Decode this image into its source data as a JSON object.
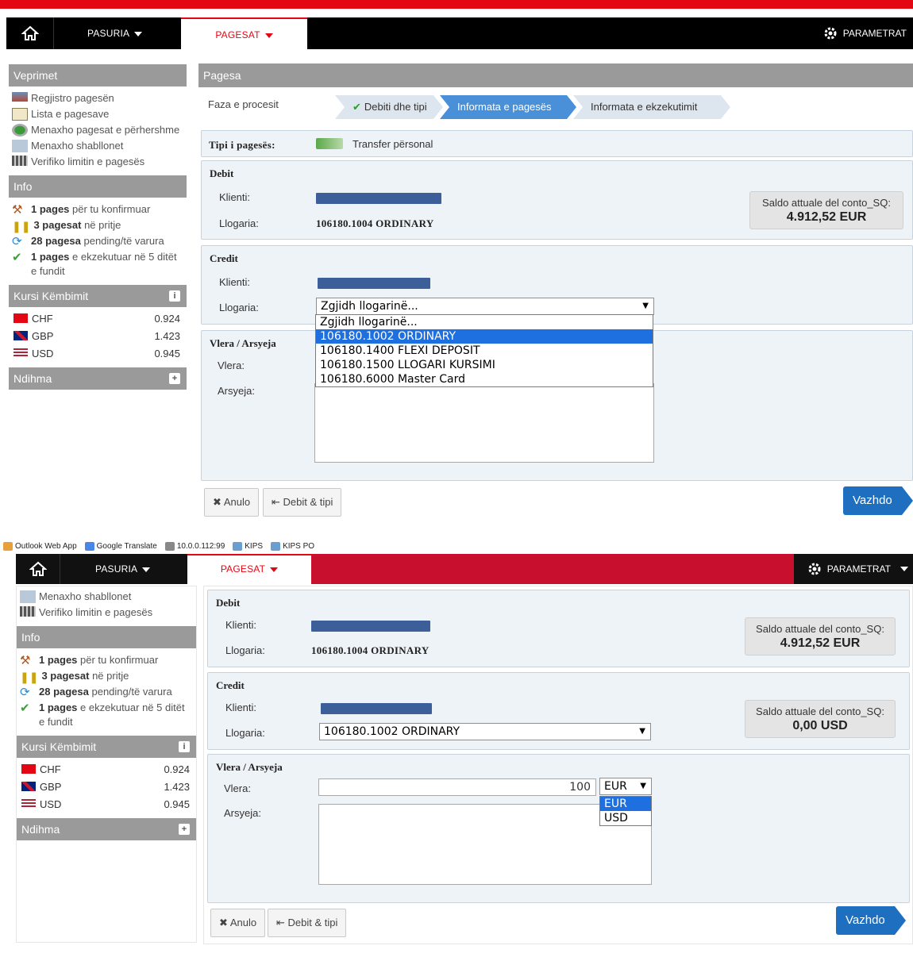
{
  "nav": {
    "pasuria": "PASURIA",
    "pagesat": "PAGESAT",
    "parametrat": "PARAMETRAT"
  },
  "bookmarks": [
    "Outlook Web App",
    "Google Translate",
    "10.0.0.112:99",
    "KIPS",
    "KIPS PO"
  ],
  "sidebar": {
    "veprimet_title": "Veprimet",
    "veprimet": [
      "Regjistro pagesën",
      "Lista e pagesave",
      "Menaxho pagesat e përhershme",
      "Menaxho shabllonet",
      "Verifiko limitin e pagesës"
    ],
    "info_title": "Info",
    "info": [
      {
        "bold": "1 pages",
        "rest": " për tu konfirmuar"
      },
      {
        "bold": "3 pagesat",
        "rest": " në pritje"
      },
      {
        "bold": "28 pagesa",
        "rest": " pending/të varura"
      },
      {
        "bold": "1 pages",
        "rest": " e ekzekutuar në 5 ditët e fundit"
      }
    ],
    "kursi_title": "Kursi Këmbimit",
    "rates": [
      {
        "code": "CHF",
        "rate": "0.924"
      },
      {
        "code": "GBP",
        "rate": "1.423"
      },
      {
        "code": "USD",
        "rate": "0.945"
      }
    ],
    "ndihma_title": "Ndihma"
  },
  "main": {
    "title": "Pagesa",
    "phase_label": "Faza e procesit",
    "steps": [
      "Debiti dhe tipi",
      "Informata e pagesës",
      "Informata e ekzekutimit"
    ],
    "tipi_label": "Tipi i pagesës:",
    "tipi_value": "Transfer përsonal",
    "debit": {
      "title": "Debit",
      "klienti_label": "Klienti:",
      "llogaria_label": "Llogaria:",
      "llogaria_value": "106180.1004 ORDINARY",
      "saldo_title": "Saldo attuale del conto_SQ:",
      "saldo_value": "4.912,52 EUR"
    },
    "credit": {
      "title": "Credit",
      "klienti_label": "Klienti:",
      "llogaria_label": "Llogaria:",
      "placeholder": "Zgjidh llogarinë...",
      "options": [
        "Zgjidh llogarinë...",
        "106180.1002 ORDINARY",
        "106180.1400 FLEXI DEPOSIT",
        "106180.1500 LLOGARI KURSIMI",
        "106180.6000 Master Card"
      ],
      "selected": "106180.1002 ORDINARY",
      "saldo_title": "Saldo attuale del conto_SQ:",
      "saldo_value": "0,00 USD"
    },
    "vlera": {
      "title": "Vlera / Arsyeja",
      "vlera_label": "Vlera:",
      "arsyeja_label": "Arsyeja:",
      "amount": "100",
      "currency": "EUR",
      "currency_options": [
        "EUR",
        "USD"
      ]
    },
    "buttons": {
      "anulo": "Anulo",
      "debit_tipi": "Debit & tipi",
      "vazhdo": "Vazhdo"
    }
  },
  "colors": {
    "brand_red": "#e30613",
    "accent_blue": "#1f6fc0",
    "nav_black": "#000000"
  }
}
